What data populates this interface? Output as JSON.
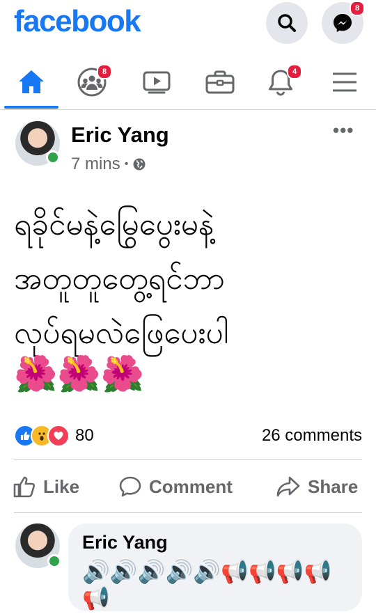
{
  "app": {
    "logo": "facebook"
  },
  "header": {
    "search_icon": "search-icon",
    "messenger_icon": "messenger-icon",
    "messenger_badge": "8"
  },
  "nav": {
    "items": [
      {
        "name": "home",
        "icon": "home-icon",
        "active": true
      },
      {
        "name": "groups",
        "icon": "groups-icon",
        "badge": "8"
      },
      {
        "name": "watch",
        "icon": "watch-icon"
      },
      {
        "name": "marketplace",
        "icon": "briefcase-icon"
      },
      {
        "name": "notifications",
        "icon": "bell-icon",
        "badge": "4"
      },
      {
        "name": "menu",
        "icon": "hamburger-icon"
      }
    ]
  },
  "post": {
    "author": "Eric Yang",
    "time": "7 mins",
    "separator": "•",
    "text_lines": [
      "ရခိုင်မနဲ့မြွေပွေးမနဲ့",
      "အတူတူတွေ့ရင်ဘာ",
      "လုပ်ရမလဲဖြေပေးပါ"
    ],
    "emoji": "🌺🌺🌺",
    "reaction_count": "80",
    "comment_count": "26 comments"
  },
  "actions": {
    "like": "Like",
    "comment": "Comment",
    "share": "Share"
  },
  "comment": {
    "author": "Eric Yang",
    "text": "🔊🔊🔊🔊🔊📢📢📢📢📢"
  },
  "colors": {
    "brand": "#1877f2",
    "badge": "#e41e3f",
    "online": "#31a24c",
    "muted": "#65676b"
  }
}
